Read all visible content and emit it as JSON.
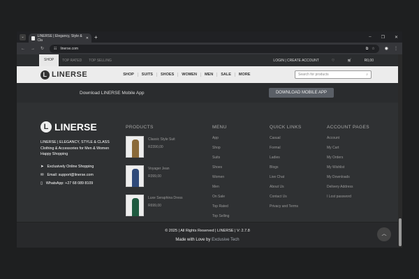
{
  "browser": {
    "tab_title": "LINERSE | Elegancy, Style & Cla",
    "url": "linerse.com"
  },
  "topbar": {
    "tabs": [
      "SHOP",
      "TOP RATED",
      "TOP SELLING"
    ],
    "login": "LOGIN | CREATE ACCOUNT",
    "cart_total": "R0,00"
  },
  "header": {
    "logo": "LINERSE",
    "nav": [
      "SHOP",
      "SUITS",
      "SHOES",
      "WOMEN",
      "MEN",
      "SALE",
      "MORE"
    ],
    "search_placeholder": "Search for products"
  },
  "app_banner": {
    "text": "Download LINERSE Mobile App",
    "button": "DOWNLOAD MOBILE APP"
  },
  "footer": {
    "brand": "LINERSE",
    "tagline": "LINERSE | ELEGANCY, STYLE & CLASS",
    "desc": "Clothing & Accessories for Men & Women",
    "desc2": "Happy Shopping",
    "contacts": [
      "Exclusively Online Shopping",
      "Email: support@linerse.com",
      "WhatsApp: +27 68 089 8109"
    ],
    "products_title": "PRODUCTS",
    "products": [
      {
        "name": "Classic Style Suit",
        "price": "R2390,00",
        "color": "#8a6a3a"
      },
      {
        "name": "Voyager Jean",
        "price": "R399,00",
        "color": "#2f4a7a"
      },
      {
        "name": "Luxe Seraphina Dress",
        "price": "R699,00",
        "color": "#1f5a40"
      }
    ],
    "menu_title": "MENU",
    "menu": [
      "App",
      "Shop",
      "Suits",
      "Shoes",
      "Women",
      "Men",
      "On Sale",
      "Top Rated",
      "Top Selling"
    ],
    "quick_title": "QUICK LINKS",
    "quick": [
      "Casual",
      "Formal",
      "Ladies",
      "Blogs",
      "Live Chat",
      "About Us",
      "Contact Us",
      "Privacy and Terms"
    ],
    "account_title": "ACCOUNT PAGES",
    "account": [
      "Account",
      "My Cart",
      "My Orders",
      "My Wishlist",
      "My Downloads",
      "Delivery Address",
      "I Lost password"
    ]
  },
  "bottom": {
    "copyright": "© 2025 | All Rights Reserved | LINERSE | V: 2.7.8",
    "made": "Made with Love by",
    "maker": "Exclusive Tech"
  }
}
